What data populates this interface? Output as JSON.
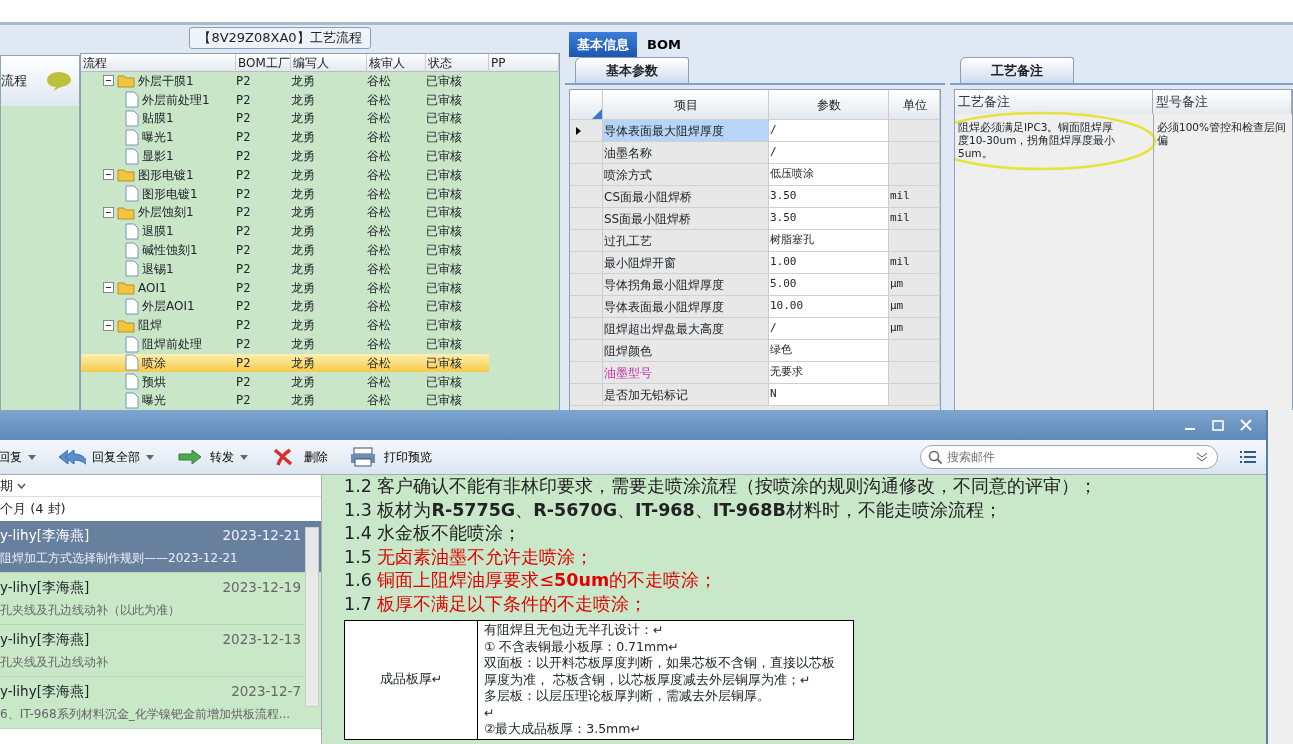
{
  "sidebar": {
    "label": "流程"
  },
  "tree_panel": {
    "title": "【8V29Z08XA0】工艺流程",
    "columns": [
      "流程",
      "BOM工厂",
      "编写人",
      "核审人",
      "状态",
      "PP"
    ],
    "nodes": [
      {
        "kind": "folder",
        "label": "外层干膜1",
        "bom": "P2",
        "author": "龙勇",
        "reviewer": "谷松",
        "status": "已审核",
        "selected": false,
        "expanded": true,
        "children": [
          {
            "kind": "file",
            "label": "外层前处理1",
            "bom": "P2",
            "author": "龙勇",
            "reviewer": "谷松",
            "status": "已审核",
            "selected": false
          },
          {
            "kind": "file",
            "label": "贴膜1",
            "bom": "P2",
            "author": "龙勇",
            "reviewer": "谷松",
            "status": "已审核",
            "selected": false
          },
          {
            "kind": "file",
            "label": "曝光1",
            "bom": "P2",
            "author": "龙勇",
            "reviewer": "谷松",
            "status": "已审核",
            "selected": false
          },
          {
            "kind": "file",
            "label": "显影1",
            "bom": "P2",
            "author": "龙勇",
            "reviewer": "谷松",
            "status": "已审核",
            "selected": false
          }
        ]
      },
      {
        "kind": "folder",
        "label": "图形电镀1",
        "bom": "P2",
        "author": "龙勇",
        "reviewer": "谷松",
        "status": "已审核",
        "selected": false,
        "expanded": true,
        "children": [
          {
            "kind": "file",
            "label": "图形电镀1",
            "bom": "P2",
            "author": "龙勇",
            "reviewer": "谷松",
            "status": "已审核",
            "selected": false
          }
        ]
      },
      {
        "kind": "folder",
        "label": "外层蚀刻1",
        "bom": "P2",
        "author": "龙勇",
        "reviewer": "谷松",
        "status": "已审核",
        "selected": false,
        "expanded": true,
        "children": [
          {
            "kind": "file",
            "label": "退膜1",
            "bom": "P2",
            "author": "龙勇",
            "reviewer": "谷松",
            "status": "已审核",
            "selected": false
          },
          {
            "kind": "file",
            "label": "碱性蚀刻1",
            "bom": "P2",
            "author": "龙勇",
            "reviewer": "谷松",
            "status": "已审核",
            "selected": false
          },
          {
            "kind": "file",
            "label": "退锡1",
            "bom": "P2",
            "author": "龙勇",
            "reviewer": "谷松",
            "status": "已审核",
            "selected": false
          }
        ]
      },
      {
        "kind": "folder",
        "label": "AOI1",
        "bom": "P2",
        "author": "龙勇",
        "reviewer": "谷松",
        "status": "已审核",
        "selected": false,
        "expanded": true,
        "children": [
          {
            "kind": "file",
            "label": "外层AOI1",
            "bom": "P2",
            "author": "龙勇",
            "reviewer": "谷松",
            "status": "已审核",
            "selected": false
          }
        ]
      },
      {
        "kind": "folder",
        "label": "阻焊",
        "bom": "P2",
        "author": "龙勇",
        "reviewer": "谷松",
        "status": "已审核",
        "selected": false,
        "expanded": true,
        "children": [
          {
            "kind": "file",
            "label": "阻焊前处理",
            "bom": "P2",
            "author": "龙勇",
            "reviewer": "谷松",
            "status": "已审核",
            "selected": false
          },
          {
            "kind": "file",
            "label": "喷涂",
            "bom": "P2",
            "author": "龙勇",
            "reviewer": "谷松",
            "status": "已审核",
            "selected": true
          },
          {
            "kind": "file",
            "label": "预烘",
            "bom": "P2",
            "author": "龙勇",
            "reviewer": "谷松",
            "status": "已审核",
            "selected": false
          },
          {
            "kind": "file",
            "label": "曝光",
            "bom": "P2",
            "author": "龙勇",
            "reviewer": "谷松",
            "status": "已审核",
            "selected": false
          }
        ]
      }
    ]
  },
  "info_panel": {
    "tabs": [
      {
        "label": "基本信息",
        "selected": true
      },
      {
        "label": "BOM",
        "selected": false
      }
    ],
    "subtab": "基本参数",
    "columns": [
      "项目",
      "参数",
      "单位"
    ],
    "rows": [
      {
        "item": "导体表面最大阻焊厚度",
        "value": "/",
        "unit": "",
        "selected": true,
        "emphasized": false
      },
      {
        "item": "油墨名称",
        "value": "/",
        "unit": "",
        "selected": false,
        "emphasized": false
      },
      {
        "item": "喷涂方式",
        "value": "低压喷涂",
        "unit": "",
        "selected": false,
        "emphasized": false
      },
      {
        "item": "CS面最小阻焊桥",
        "value": "3.50",
        "unit": "mil",
        "selected": false,
        "emphasized": false
      },
      {
        "item": "SS面最小阻焊桥",
        "value": "3.50",
        "unit": "mil",
        "selected": false,
        "emphasized": false
      },
      {
        "item": "过孔工艺",
        "value": "树脂塞孔",
        "unit": "",
        "selected": false,
        "emphasized": false
      },
      {
        "item": "最小阻焊开窗",
        "value": "1.00",
        "unit": "mil",
        "selected": false,
        "emphasized": false
      },
      {
        "item": "导体拐角最小阻焊厚度",
        "value": "5.00",
        "unit": "μm",
        "selected": false,
        "emphasized": false
      },
      {
        "item": "导体表面最小阻焊厚度",
        "value": "10.00",
        "unit": "μm",
        "selected": false,
        "emphasized": false
      },
      {
        "item": "阻焊超出焊盘最大高度",
        "value": "/",
        "unit": "μm",
        "selected": false,
        "emphasized": false
      },
      {
        "item": "阻焊颜色",
        "value": "绿色",
        "unit": "",
        "selected": false,
        "emphasized": false
      },
      {
        "item": "油墨型号",
        "value": "无要求",
        "unit": "",
        "selected": false,
        "emphasized": true
      },
      {
        "item": "是否加无铅标记",
        "value": "N",
        "unit": "",
        "selected": false,
        "emphasized": false
      }
    ]
  },
  "notes_panel": {
    "tab": "工艺备注",
    "columns": [
      "工艺备注",
      "型号备注"
    ],
    "process_note": "阻焊必须满足IPC3。铜面阻焊厚度10-30um，拐角阻焊厚度最小5um。",
    "process_note_circled": true,
    "model_note": "必须100%管控和检查层间偏"
  },
  "mail_window": {
    "toolbar": [
      {
        "label": "回复",
        "dropdown": true
      },
      {
        "label": "回复全部",
        "dropdown": true
      },
      {
        "label": "转发",
        "dropdown": true
      },
      {
        "label": "删除",
        "dropdown": false
      },
      {
        "label": "打印预览",
        "dropdown": false
      }
    ],
    "search": {
      "placeholder": "搜索邮件"
    },
    "sort_label": "期",
    "group": "个月 (4 封)",
    "messages": [
      {
        "sender": "y-lihy[李海燕]",
        "date": "2023-12-21",
        "subject": "阻焊加工方式选择制作规则——2023-12-21",
        "selected": true
      },
      {
        "sender": "y-lihy[李海燕]",
        "date": "2023-12-19",
        "subject": "孔夹线及孔边线动补（以此为准）",
        "selected": false
      },
      {
        "sender": "y-lihy[李海燕]",
        "date": "2023-12-13",
        "subject": "孔夹线及孔边线动补",
        "selected": false
      },
      {
        "sender": "y-lihy[李海燕]",
        "date": "2023-12-7",
        "subject": "6、IT-968系列材料沉金_化学镍钯金前增加烘板流程...",
        "selected": false
      }
    ],
    "body_lines": [
      {
        "num": "1.2",
        "text": "客户确认不能有非林印要求，需要走喷涂流程（按喷涂的规则沟通修改，不同意的评审）；",
        "color": "#222222"
      },
      {
        "num": "1.3",
        "text": "板材为**R-5775G**、**R-5670G**、**IT-968**、**IT-968B**材料时，不能走喷涂流程；",
        "color": "#222222"
      },
      {
        "num": "1.4",
        "text": "水金板不能喷涂；",
        "color": "#222222"
      },
      {
        "num": "1.5",
        "text": "无卤素油墨不允许走喷涂；",
        "color": "#e00000"
      },
      {
        "num": "1.6",
        "text": "铜面上阻焊油厚要求≤**50um**的不走喷涂；",
        "color": "#e00000"
      },
      {
        "num": "1.7",
        "text": "板厚不满足以下条件的不走喷涂；",
        "color": "#e00000"
      }
    ],
    "table": {
      "label": "成品板厚↵",
      "lines": [
        "有阻焊且无包边无半孔设计：↵",
        "①  不含表铜最小板厚：0.71mm↵",
        "双面板：以开料芯板厚度判断，如果芯板不含铜，直接以芯板厚度为准， 芯板含铜，以芯板厚度减去外层铜厚为准；↵",
        " 多层板：以层压理论板厚判断，需减去外层铜厚。",
        "↵",
        "②最大成品板厚：3.5mm↵"
      ]
    }
  }
}
